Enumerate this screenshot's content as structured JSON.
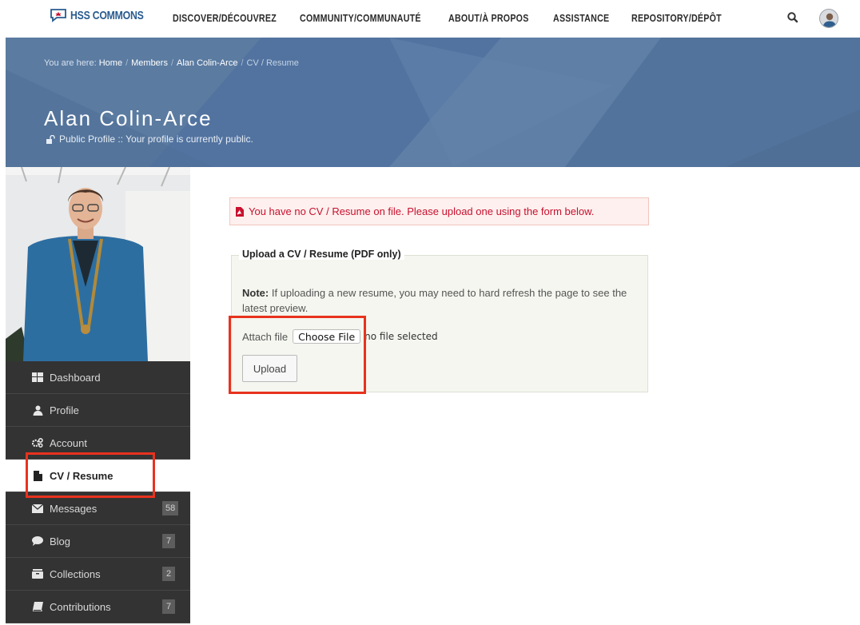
{
  "header": {
    "logo_text": "HSS COMMONS",
    "nav": [
      {
        "label": "DISCOVER/DÉCOUVREZ"
      },
      {
        "label": "COMMUNITY/COMMUNAUTÉ"
      },
      {
        "label": "ABOUT/À PROPOS"
      },
      {
        "label": "ASSISTANCE"
      },
      {
        "label": "REPOSITORY/DÉPÔT"
      }
    ],
    "icons": {
      "search": "search-icon",
      "avatar": "user-avatar"
    }
  },
  "breadcrumb": {
    "prefix": "You are here:",
    "items": [
      {
        "label": "Home"
      },
      {
        "label": "Members"
      },
      {
        "label": "Alan Colin-Arce"
      },
      {
        "label": "CV / Resume"
      }
    ]
  },
  "profile": {
    "name": "Alan Colin-Arce",
    "status": "Public Profile :: Your profile is currently public."
  },
  "sidebar": {
    "items": [
      {
        "label": "Dashboard",
        "icon": "dashboard-icon",
        "count": ""
      },
      {
        "label": "Profile",
        "icon": "user-icon",
        "count": ""
      },
      {
        "label": "Account",
        "icon": "gears-icon",
        "count": ""
      },
      {
        "label": "CV / Resume",
        "icon": "file-icon",
        "count": "",
        "active": true
      },
      {
        "label": "Messages",
        "icon": "envelope-icon",
        "count": "58"
      },
      {
        "label": "Blog",
        "icon": "comment-icon",
        "count": "7"
      },
      {
        "label": "Collections",
        "icon": "collection-icon",
        "count": "2"
      },
      {
        "label": "Contributions",
        "icon": "book-icon",
        "count": "7"
      }
    ]
  },
  "main": {
    "alert": "You have no CV / Resume on file. Please upload one using the form below.",
    "upload": {
      "legend": "Upload a CV / Resume (PDF only)",
      "note_label": "Note:",
      "note_text": " If uploading a new resume, you may need to hard refresh the page to see the latest preview.",
      "attach_label": "Attach file",
      "choose_button": "Choose File",
      "no_file_text": "no file selected",
      "upload_button": "Upload"
    }
  },
  "colors": {
    "banner": "#57779e",
    "sidebar_bg": "#333333",
    "alert_text": "#c8102e",
    "highlight": "#e8321e"
  }
}
